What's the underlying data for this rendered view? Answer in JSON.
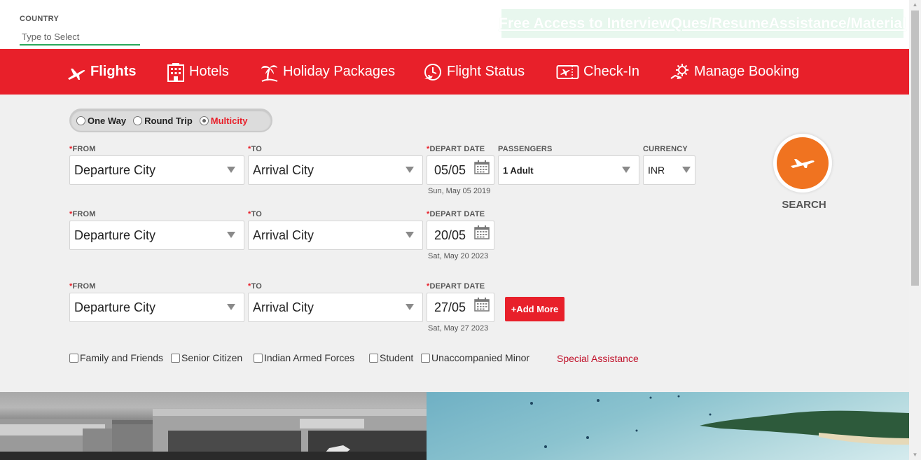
{
  "top": {
    "country_label": "COUNTRY",
    "country_placeholder": "Type to Select",
    "promo_link": "Free Access to InterviewQues/ResumeAssistance/Material"
  },
  "nav": {
    "items": [
      {
        "label": "Flights",
        "icon": "airplane-icon",
        "active": true
      },
      {
        "label": "Hotels",
        "icon": "building-icon"
      },
      {
        "label": "Holiday Packages",
        "icon": "palm-tree-icon"
      },
      {
        "label": "Flight Status",
        "icon": "clock-plane-icon"
      },
      {
        "label": "Check-In",
        "icon": "ticket-icon"
      },
      {
        "label": "Manage Booking",
        "icon": "gear-hand-icon"
      }
    ]
  },
  "trip_type": {
    "options": [
      "One Way",
      "Round Trip",
      "Multicity"
    ],
    "selected": "Multicity"
  },
  "labels": {
    "required_mark": "*",
    "from": "FROM",
    "to": "TO",
    "depart_date": "DEPART DATE",
    "passengers": "PASSENGERS",
    "currency": "CURRENCY"
  },
  "legs": [
    {
      "from": "Departure City",
      "to": "Arrival City",
      "date": "05/05",
      "date_full": "Sun, May 05 2019"
    },
    {
      "from": "Departure City",
      "to": "Arrival City",
      "date": "20/05",
      "date_full": "Sat, May 20 2023"
    },
    {
      "from": "Departure City",
      "to": "Arrival City",
      "date": "27/05",
      "date_full": "Sat, May 27 2023"
    }
  ],
  "passengers": "1 Adult",
  "currency": "INR",
  "add_more": "+Add More",
  "search_label": "SEARCH",
  "checkboxes": [
    "Family and Friends",
    "Senior Citizen",
    "Indian Armed Forces",
    "Student",
    "Unaccompanied Minor"
  ],
  "special_assistance": "Special Assistance",
  "colors": {
    "brand_red": "#e8202a",
    "search_orange": "#f07320",
    "promo_bg": "#e8f7ee",
    "country_underline": "#2aa85a"
  }
}
